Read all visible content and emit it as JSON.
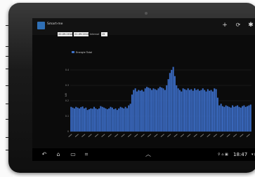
{
  "app": {
    "title": "Smart-me"
  },
  "actions": {
    "add_glyph": "+",
    "refresh_glyph": "⟳",
    "settings_glyph": "✱"
  },
  "filters": {
    "date_from": "20.09.2014",
    "date_to": "21.09.2014",
    "interval_label": "Interval",
    "interval_value": "15"
  },
  "chart_data": {
    "type": "bar",
    "legend": [
      "Energie Total"
    ],
    "ylabel": "kW",
    "ylim": [
      0,
      0.5
    ],
    "yticks": [
      "0",
      "0.1",
      "0.2",
      "0.3",
      "0.4"
    ],
    "color": "#3b6bc2",
    "values": [
      0.16,
      0.155,
      0.15,
      0.16,
      0.155,
      0.15,
      0.158,
      0.162,
      0.15,
      0.155,
      0.14,
      0.145,
      0.15,
      0.148,
      0.16,
      0.15,
      0.145,
      0.15,
      0.165,
      0.16,
      0.155,
      0.15,
      0.145,
      0.15,
      0.16,
      0.155,
      0.145,
      0.15,
      0.14,
      0.15,
      0.16,
      0.155,
      0.15,
      0.16,
      0.152,
      0.17,
      0.18,
      0.24,
      0.27,
      0.28,
      0.26,
      0.27,
      0.265,
      0.27,
      0.26,
      0.28,
      0.29,
      0.285,
      0.28,
      0.27,
      0.28,
      0.275,
      0.27,
      0.28,
      0.29,
      0.285,
      0.28,
      0.27,
      0.3,
      0.34,
      0.38,
      0.4,
      0.42,
      0.36,
      0.3,
      0.28,
      0.27,
      0.26,
      0.28,
      0.275,
      0.27,
      0.28,
      0.27,
      0.275,
      0.265,
      0.28,
      0.27,
      0.275,
      0.265,
      0.27,
      0.28,
      0.27,
      0.26,
      0.275,
      0.265,
      0.27,
      0.26,
      0.28,
      0.275,
      0.22,
      0.17,
      0.18,
      0.165,
      0.16,
      0.17,
      0.165,
      0.16,
      0.155,
      0.17,
      0.16,
      0.165,
      0.17,
      0.16,
      0.155,
      0.165,
      0.17,
      0.16,
      0.165,
      0.17,
      0.175
    ]
  },
  "statusbar": {
    "time": "18:47",
    "left_icons": "⚲ ⌂ ▣",
    "right_icons": "▾ ▮"
  },
  "nav": {
    "back_glyph": "↶",
    "home_glyph": "⌂",
    "recent_glyph": "▭",
    "screenshot_glyph": "⌗",
    "up_glyph": "︿"
  }
}
